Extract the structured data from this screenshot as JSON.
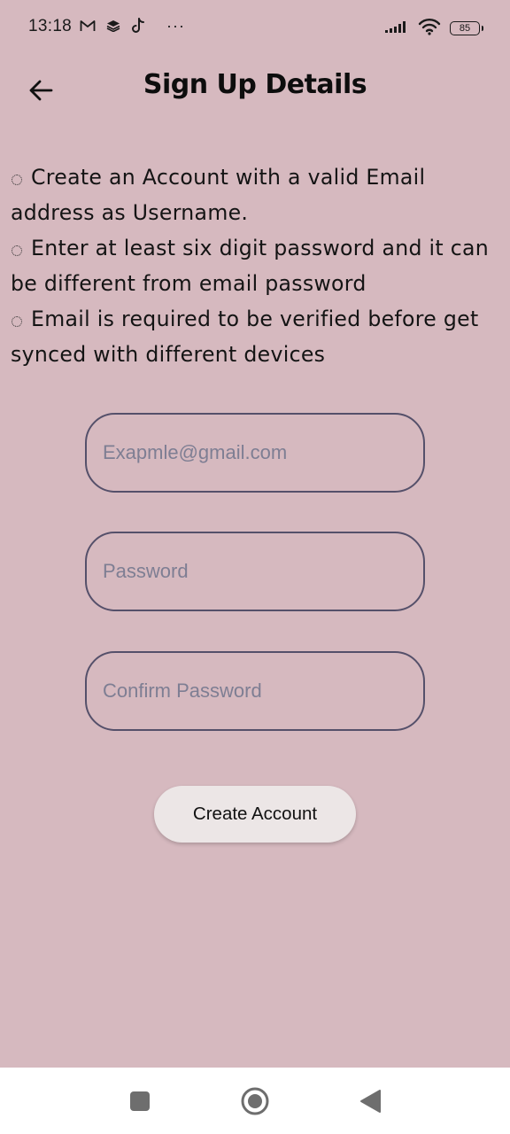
{
  "status_bar": {
    "time": "13:18",
    "left_icons": [
      "gmail-icon",
      "layers-icon",
      "tiktok-icon"
    ],
    "overflow": "···",
    "battery_level": "85"
  },
  "app_bar": {
    "title": "Sign Up Details",
    "back_icon": "arrow-left-icon"
  },
  "instructions": [
    "Create an Account with a valid Email address as Username.",
    "Enter at least six digit password and it can be different from email password",
    "Email is required to be verified before get synced with different devices"
  ],
  "form": {
    "email": {
      "placeholder": "Exapmle@gmail.com",
      "value": ""
    },
    "password": {
      "placeholder": "Password",
      "value": ""
    },
    "confirm_password": {
      "placeholder": "Confirm Password",
      "value": ""
    },
    "submit_label": "Create Account"
  },
  "colors": {
    "background": "#d6b9bf",
    "field_border": "#55506a",
    "button_bg": "#ece6e6",
    "nav_icon": "#6e6e6e"
  },
  "nav_bar": {
    "buttons": [
      "recents-icon",
      "home-icon",
      "back-triangle-icon"
    ]
  }
}
